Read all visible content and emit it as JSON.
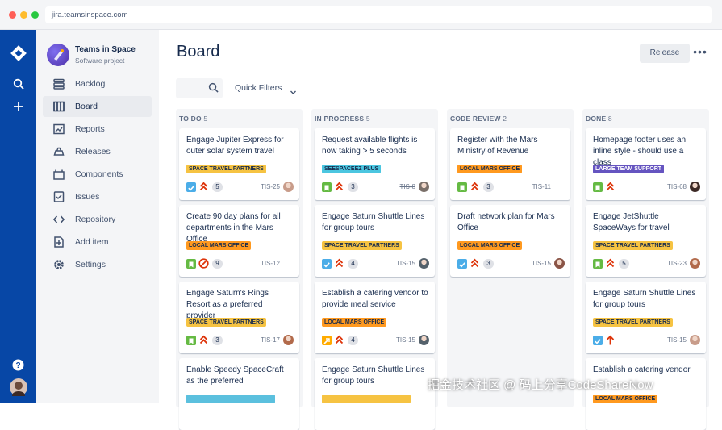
{
  "browser": {
    "url": "jira.teamsinspace.com"
  },
  "project": {
    "name": "Teams in Space",
    "type": "Software project"
  },
  "sidebar": {
    "items": [
      {
        "label": "Backlog",
        "icon": "backlog-icon"
      },
      {
        "label": "Board",
        "icon": "board-icon",
        "active": true
      },
      {
        "label": "Reports",
        "icon": "reports-icon"
      },
      {
        "label": "Releases",
        "icon": "releases-icon"
      },
      {
        "label": "Components",
        "icon": "components-icon"
      },
      {
        "label": "Issues",
        "icon": "issues-icon"
      },
      {
        "label": "Repository",
        "icon": "repository-icon"
      },
      {
        "label": "Add item",
        "icon": "add-item-icon"
      },
      {
        "label": "Settings",
        "icon": "settings-icon"
      }
    ]
  },
  "board": {
    "title": "Board",
    "release_label": "Release",
    "more_label": "•••",
    "quick_filters_label": "Quick Filters",
    "columns": [
      {
        "name": "TO DO",
        "count": "5",
        "cards": [
          {
            "title": "Engage Jupiter Express for outer solar system travel",
            "label": "SPACE TRAVEL PARTNERS",
            "label_color": "#f6c342",
            "type": "task",
            "priority": "highest",
            "points": "5",
            "key": "TIS-25",
            "avatar": "#c89c8a"
          },
          {
            "title": "Create 90 day plans for all departments in the Mars Office",
            "label": "LOCAL MARS OFFICE",
            "label_color": "#ff991f",
            "type": "story",
            "priority": "blocker",
            "points": "9",
            "key": "TIS-12",
            "avatar": ""
          },
          {
            "title": "Engage Saturn's Rings Resort as a preferred provider",
            "label": "SPACE TRAVEL PARTNERS",
            "label_color": "#f6c342",
            "type": "story",
            "priority": "highest",
            "points": "3",
            "key": "TIS-17",
            "avatar": "#b26a4b"
          },
          {
            "title": "Enable Speedy SpaceCraft as the preferred",
            "label": "",
            "label_color": "#5bc0de",
            "type": "",
            "priority": "",
            "points": "",
            "key": "",
            "avatar": ""
          }
        ]
      },
      {
        "name": "IN PROGRESS",
        "count": "5",
        "cards": [
          {
            "title": "Request available flights is now taking > 5 seconds",
            "label": "SEESPACEEZ PLUS",
            "label_color": "#4bc6e0",
            "type": "story",
            "priority": "highest",
            "points": "3",
            "key": "TIS-8",
            "key_strike": true,
            "avatar": "#7a6f69"
          },
          {
            "title": "Engage Saturn Shuttle Lines for group tours",
            "label": "SPACE TRAVEL PARTNERS",
            "label_color": "#f6c342",
            "type": "task",
            "priority": "high",
            "points": "4",
            "key": "TIS-15",
            "avatar": "#54616b"
          },
          {
            "title": "Establish a catering vendor to provide meal service",
            "label": "LOCAL MARS OFFICE",
            "label_color": "#ff991f",
            "type": "improvement",
            "priority": "high",
            "points": "4",
            "key": "TIS-15",
            "avatar": "#54616b"
          },
          {
            "title": "Engage Saturn Shuttle Lines for group tours",
            "label": "",
            "label_color": "#f6c342",
            "type": "",
            "priority": "",
            "points": "",
            "key": "",
            "avatar": ""
          }
        ]
      },
      {
        "name": "CODE REVIEW",
        "count": "2",
        "cards": [
          {
            "title": "Register with the Mars Ministry of Revenue",
            "label": "LOCAL MARS OFFICE",
            "label_color": "#ff991f",
            "type": "story",
            "priority": "highest",
            "points": "3",
            "key": "TIS-11",
            "avatar": ""
          },
          {
            "title": "Draft network plan for Mars Office",
            "label": "LOCAL MARS OFFICE",
            "label_color": "#ff991f",
            "type": "task",
            "priority": "highest",
            "points": "3",
            "key": "TIS-15",
            "avatar": "#8a5446"
          }
        ]
      },
      {
        "name": "DONE",
        "count": "8",
        "cards": [
          {
            "title": "Homepage footer uses an inline style - should use a class",
            "label": "LARGE TEAM SUPPORT",
            "label_color": "#6554c0",
            "type": "story",
            "priority": "highest",
            "points": "",
            "key": "TIS-68",
            "avatar": "#3d2a26"
          },
          {
            "title": "Engage JetShuttle SpaceWays for travel",
            "label": "SPACE TRAVEL PARTNERS",
            "label_color": "#f6c342",
            "type": "story",
            "priority": "high",
            "points": "5",
            "key": "TIS-23",
            "avatar": "#b26a4b"
          },
          {
            "title": "Engage Saturn Shuttle Lines for group tours",
            "label": "SPACE TRAVEL PARTNERS",
            "label_color": "#f6c342",
            "type": "task",
            "priority": "critical",
            "points": "",
            "key": "TIS-15",
            "avatar": "#c89c8a"
          },
          {
            "title": "Establish a catering vendor",
            "label": "LOCAL MARS OFFICE",
            "label_color": "#ff991f",
            "type": "",
            "priority": "",
            "points": "",
            "key": "",
            "avatar": ""
          }
        ]
      }
    ]
  },
  "watermark": "掘金技术社区 @ 码上分享CodeShareNow",
  "colors": {
    "global_nav": "#0747a6",
    "sidebar_bg": "#f4f5f7",
    "column_bg": "#f4f5f7",
    "priority_red": "#de350b"
  }
}
